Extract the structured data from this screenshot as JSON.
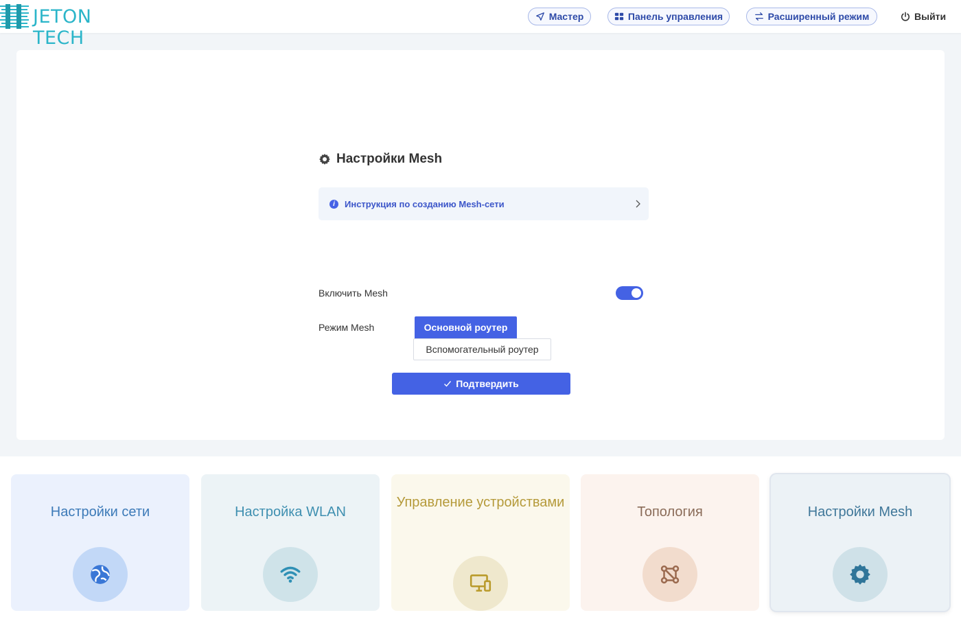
{
  "header": {
    "logo_text": "JETON TECH",
    "nav": [
      {
        "label": "Мастер",
        "icon": "send-icon"
      },
      {
        "label": "Панель управления",
        "icon": "dashboard-icon"
      },
      {
        "label": "Расширенный режим",
        "icon": "swap-icon"
      }
    ],
    "logout_label": "Выйти"
  },
  "panel": {
    "title": "Настройки Mesh",
    "guide_text": "Инструкция по созданию Mesh-сети",
    "enable_label": "Включить Mesh",
    "enable_on": true,
    "mode_label": "Режим Mesh",
    "mode_options": [
      "Основной роутер",
      "Вспомогательный роутер"
    ],
    "mode_selected": "Основной роутер",
    "confirm_label": "Подтвердить"
  },
  "tiles": [
    {
      "title": "Настройки сети",
      "icon": "globe-icon",
      "bg": "#ebf1fd",
      "text_color": "#3c7ab8",
      "circle": "#c2d8f7",
      "icon_color": "#3a77d6"
    },
    {
      "title": "Настройка WLAN",
      "icon": "wifi-icon",
      "bg": "#ecf3f6",
      "text_color": "#3e8fb0",
      "circle": "#cfe3e9",
      "icon_color": "#2f90b5"
    },
    {
      "title": "Управление устройствами",
      "icon": "devices-icon",
      "bg": "#fbf8ec",
      "text_color": "#b59a3a",
      "circle": "#efe8cd",
      "icon_color": "#b99a2a"
    },
    {
      "title": "Топология",
      "icon": "topology-icon",
      "bg": "#fcf3ee",
      "text_color": "#8a6b58",
      "circle": "#f2dccd",
      "icon_color": "#9b6a4f"
    },
    {
      "title": "Настройки Mesh",
      "icon": "gear-icon",
      "bg": "#ecf2f6",
      "text_color": "#3f7799",
      "circle": "#cfe1e8",
      "icon_color": "#2f7599",
      "selected": true
    }
  ]
}
